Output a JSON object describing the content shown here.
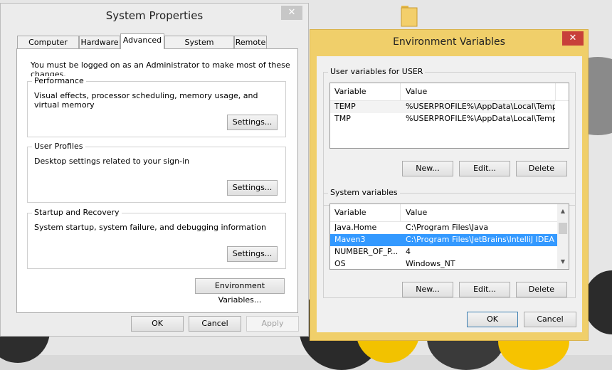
{
  "system_properties": {
    "title": "System Properties",
    "close_label": "✕",
    "tabs": [
      {
        "label": "Computer Name"
      },
      {
        "label": "Hardware"
      },
      {
        "label": "Advanced"
      },
      {
        "label": "System Protection"
      },
      {
        "label": "Remote"
      }
    ],
    "admin_notice": "You must be logged on as an Administrator to make most of these changes.",
    "performance": {
      "legend": "Performance",
      "description": "Visual effects, processor scheduling, memory usage, and virtual memory",
      "button": "Settings..."
    },
    "user_profiles": {
      "legend": "User Profiles",
      "description": "Desktop settings related to your sign-in",
      "button": "Settings..."
    },
    "startup_recovery": {
      "legend": "Startup and Recovery",
      "description": "System startup, system failure, and debugging information",
      "button": "Settings..."
    },
    "env_vars_button": "Environment Variables...",
    "ok": "OK",
    "cancel": "Cancel",
    "apply": "Apply"
  },
  "environment_variables": {
    "title": "Environment Variables",
    "close_label": "✕",
    "user_section": {
      "legend": "User variables for USER",
      "headers": {
        "variable": "Variable",
        "value": "Value"
      },
      "rows": [
        {
          "variable": "TEMP",
          "value": "%USERPROFILE%\\AppData\\Local\\Temp"
        },
        {
          "variable": "TMP",
          "value": "%USERPROFILE%\\AppData\\Local\\Temp"
        }
      ],
      "buttons": {
        "new": "New...",
        "edit": "Edit...",
        "delete": "Delete"
      }
    },
    "system_section": {
      "legend": "System variables",
      "headers": {
        "variable": "Variable",
        "value": "Value"
      },
      "rows": [
        {
          "variable": "Java.Home",
          "value": "C:\\Program Files\\Java"
        },
        {
          "variable": "Maven3",
          "value": "C:\\Program Files\\JetBrains\\IntelliJ IDEA ..."
        },
        {
          "variable": "NUMBER_OF_P...",
          "value": "4"
        },
        {
          "variable": "OS",
          "value": "Windows_NT"
        }
      ],
      "selected_row": "Maven3",
      "buttons": {
        "new": "New...",
        "edit": "Edit...",
        "delete": "Delete"
      }
    },
    "ok": "OK",
    "cancel": "Cancel"
  },
  "colors": {
    "env_window_frame": "#f0cf6a",
    "selection": "#3399ff",
    "close_button_red": "#c8403a"
  }
}
